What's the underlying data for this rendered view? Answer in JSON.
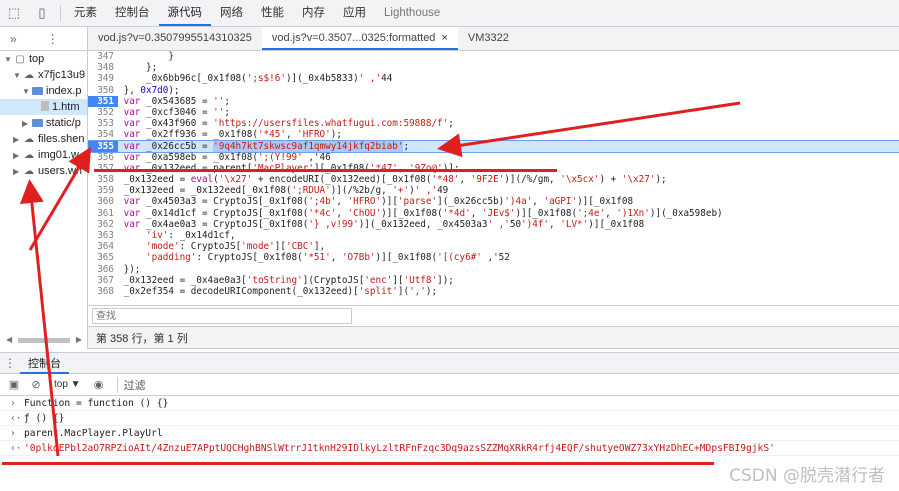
{
  "toolbar": {
    "icons": [
      "inspect-icon",
      "device-icon"
    ],
    "tabs": [
      "元素",
      "控制台",
      "源代码",
      "网络",
      "性能",
      "内存",
      "应用",
      "Lighthouse"
    ],
    "active_tab": "源代码"
  },
  "navigator": {
    "tree": [
      {
        "label": "top",
        "indent": 0,
        "kind": "frame",
        "arrow": "▼"
      },
      {
        "label": "x7fjc13u9",
        "indent": 1,
        "kind": "cloud",
        "arrow": "▼"
      },
      {
        "label": "index.p",
        "indent": 2,
        "kind": "folder",
        "arrow": "▼"
      },
      {
        "label": "1.htm",
        "indent": 3,
        "kind": "file",
        "arrow": "",
        "selected": true
      },
      {
        "label": "static/p",
        "indent": 2,
        "kind": "folder",
        "arrow": "▶"
      },
      {
        "label": "files.shen",
        "indent": 1,
        "kind": "cloud",
        "arrow": "▶"
      },
      {
        "label": "img01.w",
        "indent": 1,
        "kind": "cloud",
        "arrow": "▶"
      },
      {
        "label": "users.wh",
        "indent": 1,
        "kind": "cloud",
        "arrow": "▶"
      }
    ]
  },
  "editor": {
    "tabs": [
      {
        "label": "vod.js?v=0.3507995514310325",
        "active": false,
        "close": false
      },
      {
        "label": "vod.js?v=0.3507...0325:formatted",
        "active": true,
        "close": true
      },
      {
        "label": "VM3322",
        "active": false,
        "close": false
      }
    ],
    "lines": [
      {
        "n": "347",
        "t": "        }"
      },
      {
        "n": "348",
        "t": "    };"
      },
      {
        "n": "349",
        "t": "    _0x6bb96c[_0x1f08(';s$!6')](_0x4b5833)' ,'44"
      },
      {
        "n": "350",
        "t": "}, 0x7d0);"
      },
      {
        "n": "351",
        "t": "var _0x543685 = '';",
        "bp": true
      },
      {
        "n": "352",
        "t": "var _0xcf3046 = '';"
      },
      {
        "n": "353",
        "t": "var _0x43f960 = 'https://usersfiles.whatfugui.com:59888/f';"
      },
      {
        "n": "354",
        "t": "var _0x2ff936 = _0x1f08('*45', 'HFRO');"
      },
      {
        "n": "355",
        "t": "var _0x26cc5b = '9q4h7kt7skwsc9af1qmwy14jkfq2biab';",
        "bp": true,
        "hl": true
      },
      {
        "n": "356",
        "t": "var _0xa598eb = _0x1f08(';(Y!99' ,'46"
      },
      {
        "n": "357",
        "t": "var _0x132eed = parent['MacPlayer'][_0x1f08('*47', '9Zo@')];"
      },
      {
        "n": "358",
        "t": "_0x132eed = eval('\\x27' + encodeURI(_0x132eed)[_0x1f08('*48', '9F2E')](/%/gm, '\\x5cx') + '\\x27');"
      },
      {
        "n": "359",
        "t": "_0x132eed = _0x132eed[_0x1f08(';RDUA')](/%2b/g, '+')' ,'49"
      },
      {
        "n": "360",
        "t": "var _0x4503a3 = CryptoJS[_0x1f08(';4b', 'HFRO')]['parse'](_0x26cc5b)')4a', 'aGPI')][_0x1f08"
      },
      {
        "n": "361",
        "t": "var _0x14d1cf = CryptoJS[_0x1f08('*4c', 'ChOU')][_0x1f08('*4d', 'JEv$')][_0x1f08(';4e', ')1Xn')](_0xa598eb)"
      },
      {
        "n": "362",
        "t": "var _0x4ae0a3 = CryptoJS[_0x1f08('} ,v!99')](_0x132eed, _0x4503a3' ,'50')4f', 'LV*')][_0x1f08"
      },
      {
        "n": "363",
        "t": "    'iv': _0x14d1cf,"
      },
      {
        "n": "364",
        "t": "    'mode': CryptoJS['mode']['CBC'],"
      },
      {
        "n": "365",
        "t": "    'padding': CryptoJS[_0x1f08('*51', 'O7Bb')][_0x1f08('[(cy6#' ,'52"
      },
      {
        "n": "366",
        "t": "});"
      },
      {
        "n": "367",
        "t": "_0x132eed = _0x4ae0a3['toString'](CryptoJS['enc']['Utf8']);"
      },
      {
        "n": "368",
        "t": "_0x2ef354 = decodeURIComponent(_0x132eed)['split'](',');"
      }
    ],
    "highlight_key": "9q4h7kt7skwsc9af1qmwy14jkfq2biab",
    "search_placeholder": "查找",
    "status": "第 358 行，第 1 列"
  },
  "drawer": {
    "tab": "控制台",
    "context": "top ▼",
    "filter_label": "过滤"
  },
  "console": {
    "rows": [
      {
        "prefix": "›",
        "text": "Function = function () {}",
        "kind": "input"
      },
      {
        "prefix": "‹·",
        "text": "ƒ () {}",
        "kind": "result"
      },
      {
        "prefix": "›",
        "text": "parent.MacPlayer.PlayUrl",
        "kind": "input"
      },
      {
        "prefix": "‹·",
        "text": "'0plkdEPbl2aO7RPZioAIt/4ZnzuE7APptUQCHghBNSlWtrrJ1tknH29IDlkyLzltRFnFzqc3Dq9azsSZZMqXRkR4rfj4EQF/shutyeOWZ73xYHzDhEC+MDpsFBI9gjkS'",
        "kind": "output"
      }
    ]
  },
  "watermark": "CSDN @脱壳潜行者",
  "colors": {
    "accent": "#1a73e8",
    "annotation": "#e02020",
    "highlight": "#d2e3fc"
  }
}
